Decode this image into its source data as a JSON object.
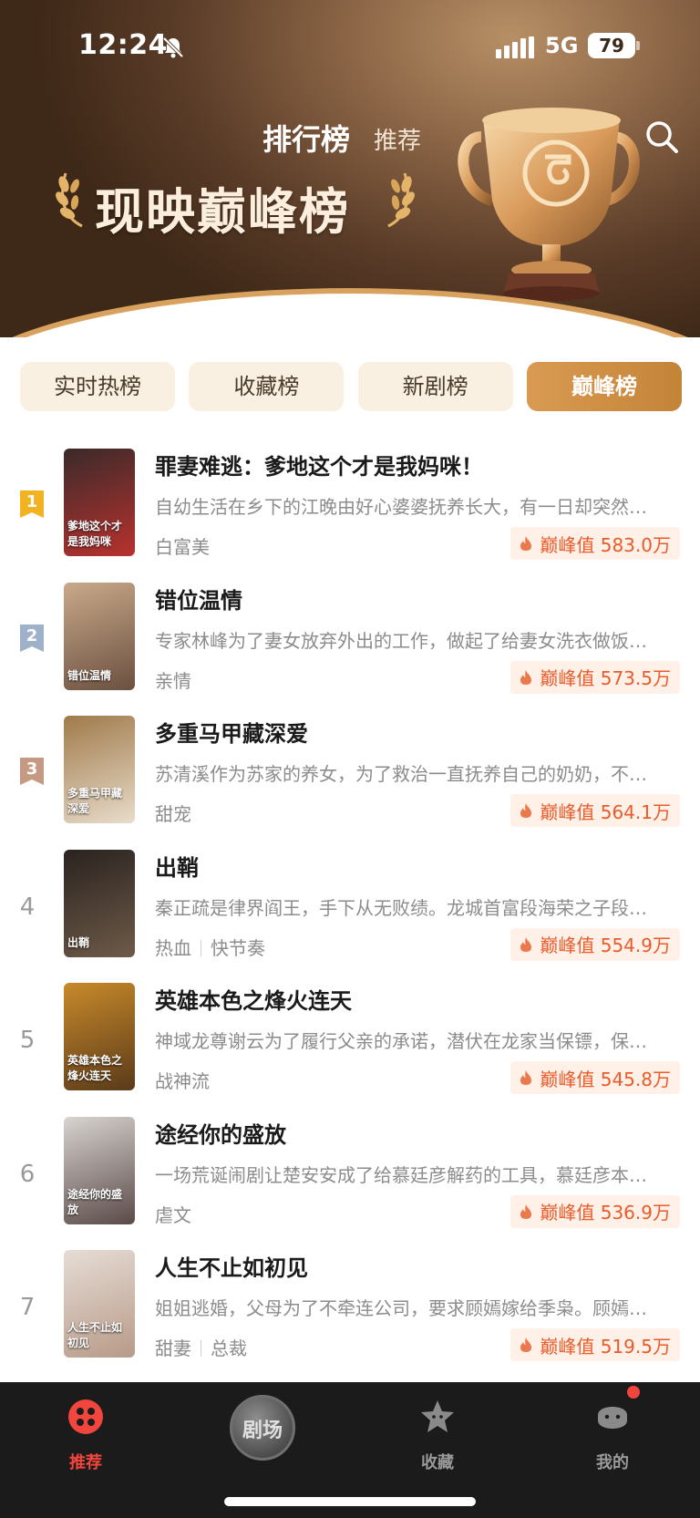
{
  "status_bar": {
    "time": "12:24",
    "network": "5G",
    "battery": "79"
  },
  "top_tabs": {
    "ranking": "排行榜",
    "recommend": "推荐"
  },
  "banner": {
    "title": "现映巅峰榜"
  },
  "category_tabs": [
    {
      "label": "实时热榜",
      "active": false
    },
    {
      "label": "收藏榜",
      "active": false
    },
    {
      "label": "新剧榜",
      "active": false
    },
    {
      "label": "巅峰榜",
      "active": true
    }
  ],
  "items": [
    {
      "rank": "1",
      "title": "罪妻难逃：爹地这个才是我妈咪！",
      "desc": "自幼生活在乡下的江晚由好心婆婆抚养长大，有一日却突然…",
      "tags": [
        "白富美"
      ],
      "peak": "巅峰值 583.0万",
      "poster_text": "爹地这个才是我妈咪",
      "poster_colors": [
        "#3a2a2a",
        "#b8322e"
      ]
    },
    {
      "rank": "2",
      "title": "错位温情",
      "desc": "专家林峰为了妻女放弃外出的工作，做起了给妻女洗衣做饭…",
      "tags": [
        "亲情"
      ],
      "peak": "巅峰值 573.5万",
      "poster_text": "错位温情",
      "poster_colors": [
        "#c9a98a",
        "#6b5040"
      ]
    },
    {
      "rank": "3",
      "title": "多重马甲藏深爱",
      "desc": "苏清溪作为苏家的养女，为了救治一直抚养自己的奶奶，不…",
      "tags": [
        "甜宠"
      ],
      "peak": "巅峰值 564.1万",
      "poster_text": "多重马甲藏深爱",
      "poster_colors": [
        "#a07a4a",
        "#e8dccb"
      ]
    },
    {
      "rank": "4",
      "title": "出鞘",
      "desc": "秦正疏是律界阎王，手下从无败绩。龙城首富段海荣之子段…",
      "tags": [
        "热血",
        "快节奏"
      ],
      "peak": "巅峰值 554.9万",
      "poster_text": "出鞘",
      "poster_colors": [
        "#2a2320",
        "#6e5a48"
      ]
    },
    {
      "rank": "5",
      "title": "英雄本色之烽火连天",
      "desc": "神域龙尊谢云为了履行父亲的承诺，潜伏在龙家当保镖，保…",
      "tags": [
        "战神流"
      ],
      "peak": "巅峰值 545.8万",
      "poster_text": "英雄本色之烽火连天",
      "poster_colors": [
        "#c88a2a",
        "#5a3a1a"
      ]
    },
    {
      "rank": "6",
      "title": "途经你的盛放",
      "desc": "一场荒诞闹剧让楚安安成了给慕廷彦解药的工具，慕廷彦本…",
      "tags": [
        "虐文"
      ],
      "peak": "巅峰值 536.9万",
      "poster_text": "途经你的盛放",
      "poster_colors": [
        "#d8d4d0",
        "#5a4a48"
      ]
    },
    {
      "rank": "7",
      "title": "人生不止如初见",
      "desc": "姐姐逃婚，父母为了不牵连公司，要求顾嫣嫁给季枭。顾嫣…",
      "tags": [
        "甜妻",
        "总裁"
      ],
      "peak": "巅峰值 519.5万",
      "poster_text": "人生不止如初见",
      "poster_colors": [
        "#e6ddd6",
        "#b89a88"
      ]
    }
  ],
  "badge_colors": {
    "1": "#f3b21f",
    "2": "#9fb0c9",
    "3": "#c69a82"
  },
  "bottom_nav": {
    "recommend": "推荐",
    "theater": "剧场",
    "favorites": "收藏",
    "mine": "我的"
  },
  "colors": {
    "accent": "#f2453d",
    "peak_text": "#ea5b2a",
    "active_tab": "#c98a3e"
  }
}
